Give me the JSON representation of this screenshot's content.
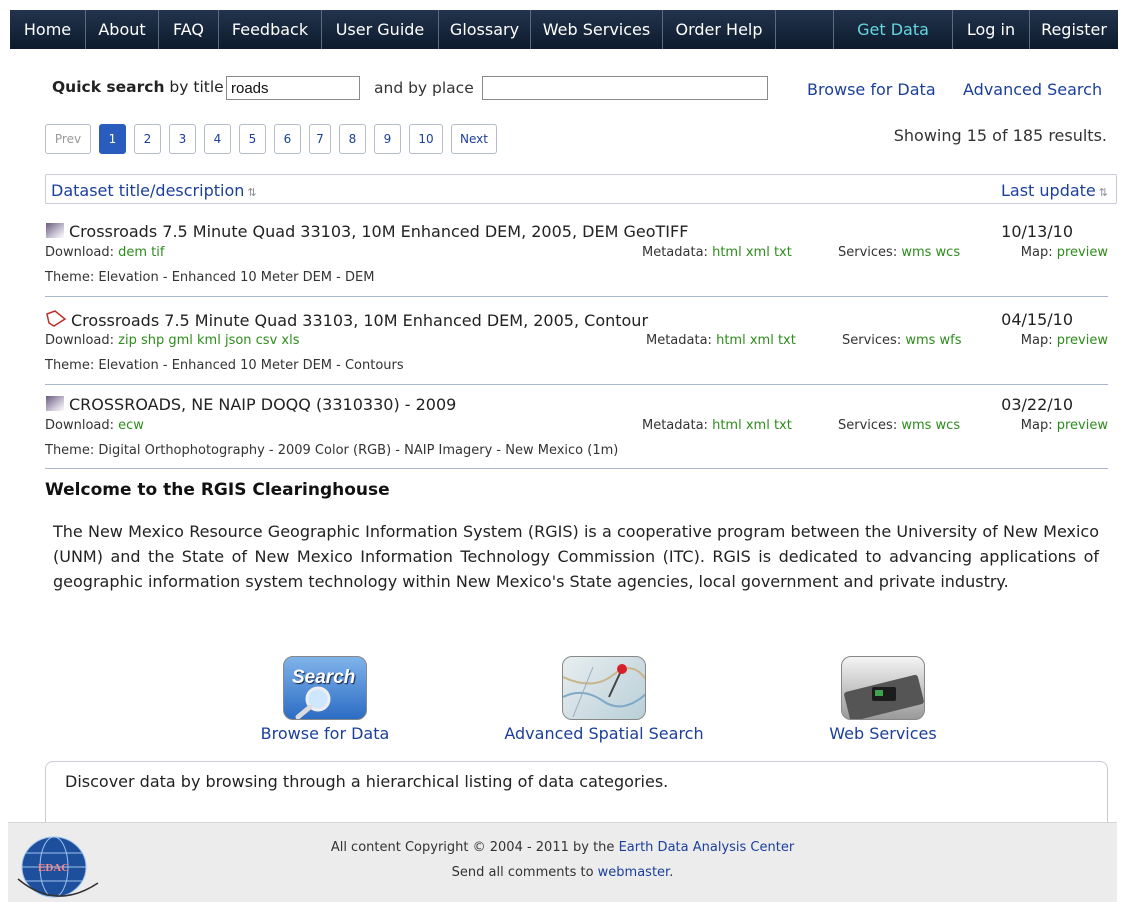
{
  "nav": {
    "items": [
      "Home",
      "About",
      "FAQ",
      "Feedback",
      "User Guide",
      "Glossary",
      "Web Services",
      "Order Help"
    ],
    "get_data": "Get Data",
    "login": "Log in",
    "register": "Register"
  },
  "search": {
    "quick_label": "Quick search",
    "by_title_label": "by title",
    "title_value": "roads",
    "by_place_label": "and by place",
    "place_value": "",
    "browse_link": "Browse for Data",
    "advanced_link": "Advanced Search"
  },
  "pagination": {
    "prev": "Prev",
    "pages": [
      "1",
      "2",
      "3",
      "4",
      "5",
      "6",
      "7",
      "8",
      "9",
      "10"
    ],
    "current": "1",
    "next": "Next",
    "showing": "Showing 15 of 185 results."
  },
  "table": {
    "col_title": "Dataset title/description",
    "col_update": "Last update",
    "rows": [
      {
        "title": "Crossroads 7.5 Minute Quad 33103, 10M Enhanced DEM, 2005, DEM GeoTIFF",
        "date": "10/13/10",
        "download_label": "Download:",
        "downloads": "dem tif",
        "metadata_label": "Metadata:",
        "metadata": "html xml txt",
        "services_label": "Services:",
        "services": "wms wcs",
        "map_label": "Map:",
        "map": "preview",
        "theme": "Theme: Elevation - Enhanced 10 Meter DEM - DEM",
        "icon": "raster-icon"
      },
      {
        "title": "Crossroads 7.5 Minute Quad 33103, 10M Enhanced DEM, 2005, Contour",
        "date": "04/15/10",
        "download_label": "Download:",
        "downloads": "zip shp gml kml json csv xls",
        "metadata_label": "Metadata:",
        "metadata": "html xml txt",
        "services_label": "Services:",
        "services": "wms wfs",
        "map_label": "Map:",
        "map": "preview",
        "theme": "Theme: Elevation - Enhanced 10 Meter DEM - Contours",
        "icon": "polygon-icon"
      },
      {
        "title": "CROSSROADS, NE NAIP DOQQ (3310330) - 2009",
        "date": "03/22/10",
        "download_label": "Download:",
        "downloads": "ecw",
        "metadata_label": "Metadata:",
        "metadata": "html xml txt",
        "services_label": "Services:",
        "services": "wms wcs",
        "map_label": "Map:",
        "map": "preview",
        "theme": "Theme: Digital Orthophotography - 2009 Color (RGB) - NAIP Imagery - New Mexico (1m)",
        "icon": "raster-icon"
      }
    ]
  },
  "welcome": {
    "heading": "Welcome to the RGIS Clearinghouse",
    "text": "The New Mexico Resource Geographic Information System (RGIS) is a cooperative program between the University of New Mexico (UNM) and the State of New Mexico Information Technology Commission (ITC). RGIS is dedicated to advancing applications of geographic information system technology within New Mexico's State agencies, local government and private industry."
  },
  "features": {
    "browse": "Browse for Data",
    "browse_tile_text": "Search",
    "spatial": "Advanced Spatial Search",
    "web": "Web Services",
    "description": "Discover data by browsing through a hierarchical listing of data categories."
  },
  "footer": {
    "copyright_prefix": "All content Copyright © 2004 - 2011 by the ",
    "org_link": "Earth Data Analysis Center",
    "comments_prefix": "Send all comments to ",
    "webmaster_link": "webmaster",
    "logo_text": "EDAC"
  }
}
